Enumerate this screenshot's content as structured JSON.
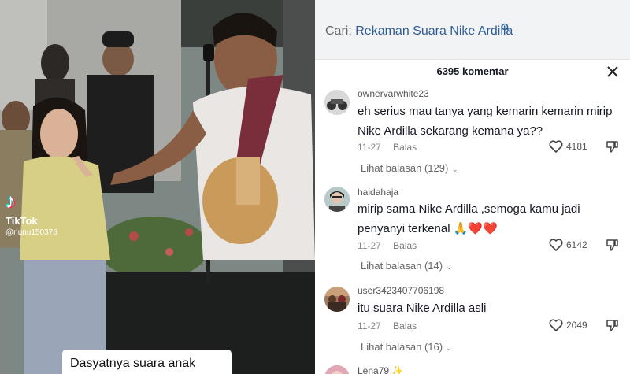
{
  "video": {
    "tiktok_logo": "TikTok",
    "handle": "@nunu150376",
    "caption": "Dasyatnya suara anak"
  },
  "search": {
    "prefix": "Cari:",
    "query": "Rekaman Suara Nike Ardilla"
  },
  "comments_header": {
    "count_label": "6395 komentar"
  },
  "comments": [
    {
      "username": "ownervarwhite23",
      "text_line1": "eh serius mau tanya yang kemarin kemarin mirip",
      "text_line2": "Nike Ardilla sekarang kemana ya??",
      "date": "11-27",
      "reply_label": "Balas",
      "likes": "4181",
      "view_replies": "Lihat balasan (129)"
    },
    {
      "username": "haidahaja",
      "text_line1": "mirip sama Nike Ardilla ,semoga kamu jadi",
      "text_line2": "penyanyi terkenal 🙏❤️❤️",
      "date": "11-27",
      "reply_label": "Balas",
      "likes": "6142",
      "view_replies": "Lihat balasan (14)"
    },
    {
      "username": "user3423407706198",
      "text_line1": "itu suara Nike Ardilla asli",
      "date": "11-27",
      "reply_label": "Balas",
      "likes": "2049",
      "view_replies": "Lihat balasan (16)"
    },
    {
      "username": "Lena79 ✨"
    }
  ],
  "icons": {
    "search": "search-icon",
    "close": "close-icon",
    "like": "heart-outline-icon",
    "dislike": "thumbs-down-icon",
    "expand": "chevron-down-icon"
  }
}
